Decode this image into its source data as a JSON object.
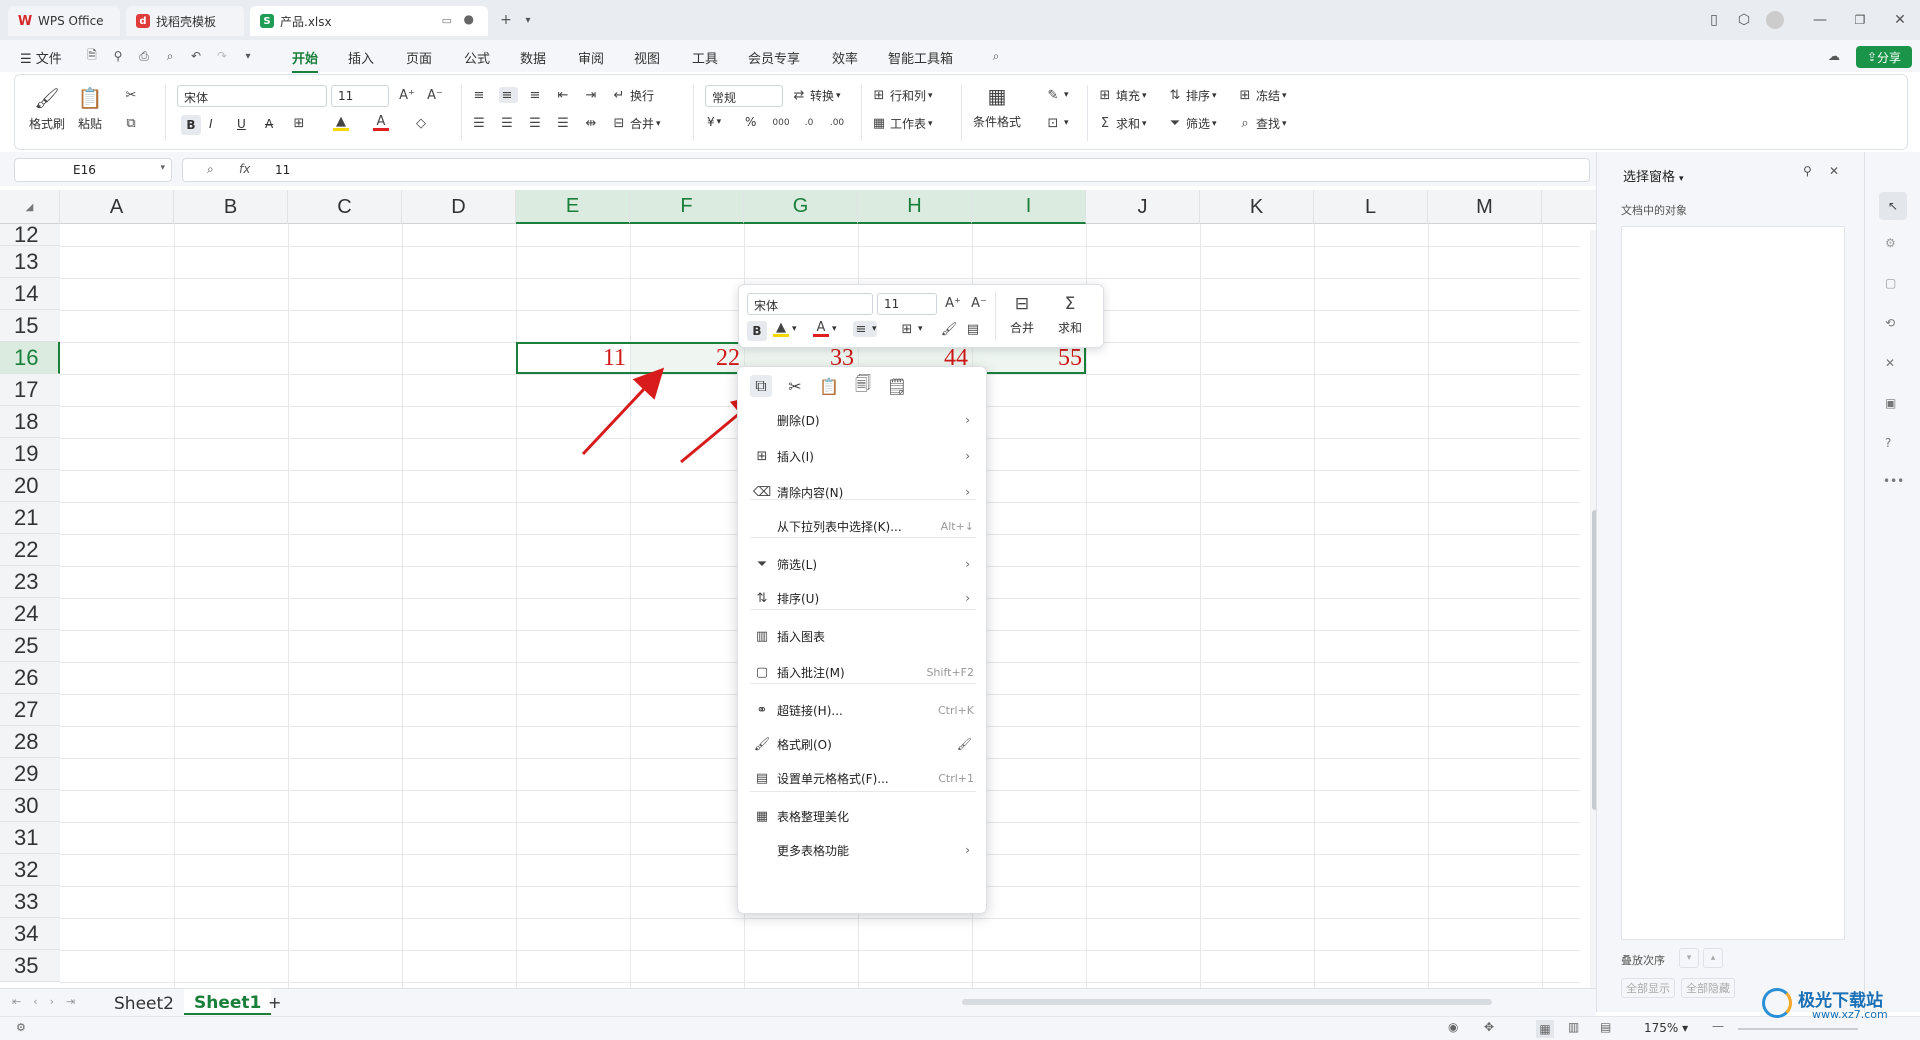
{
  "tabs": [
    {
      "label": "WPS Office"
    },
    {
      "label": "找稻壳模板"
    },
    {
      "label": "产品.xlsx"
    }
  ],
  "menu": {
    "file": "文件",
    "items": [
      "开始",
      "插入",
      "页面",
      "公式",
      "数据",
      "审阅",
      "视图",
      "工具",
      "会员专享",
      "效率",
      "智能工具箱"
    ],
    "active": "开始",
    "share": "分享"
  },
  "ribbon": {
    "format_painter": "格式刷",
    "paste": "粘贴",
    "font": "宋体",
    "size": "11",
    "wrap": "换行",
    "merge": "合并",
    "number_format": "常规",
    "convert": "转换",
    "rowcol": "行和列",
    "worksheet": "工作表",
    "cond_format": "条件格式",
    "fill": "填充",
    "sort": "排序",
    "freeze": "冻结",
    "sum": "求和",
    "filter": "筛选",
    "find": "查找",
    "currency": "¥",
    "percent": "%"
  },
  "formula": {
    "cell_ref": "E16",
    "fx": "fx",
    "value": "11"
  },
  "columns": [
    "A",
    "B",
    "C",
    "D",
    "E",
    "F",
    "G",
    "H",
    "I",
    "J",
    "K",
    "L",
    "M"
  ],
  "rows": [
    "12",
    "13",
    "14",
    "15",
    "16",
    "17",
    "18",
    "19",
    "20",
    "21",
    "22",
    "23",
    "24",
    "25",
    "26",
    "27",
    "28",
    "29",
    "30",
    "31",
    "32",
    "33",
    "34",
    "35"
  ],
  "selected_row": "16",
  "cells": [
    "11",
    "22",
    "33",
    "44",
    "55"
  ],
  "mini_toolbar": {
    "font": "宋体",
    "size": "11",
    "bold": "B",
    "merge": "合并",
    "sum": "求和"
  },
  "context_menu": [
    {
      "label": "删除(D)",
      "shortcut": "",
      "submenu": true,
      "icon": ""
    },
    {
      "label": "插入(I)",
      "shortcut": "",
      "submenu": true,
      "icon": "insert-icon"
    },
    {
      "label": "清除内容(N)",
      "shortcut": "",
      "submenu": true,
      "icon": "clear-icon"
    },
    {
      "label": "从下拉列表中选择(K)...",
      "shortcut": "Alt+↓",
      "submenu": false,
      "icon": ""
    },
    {
      "label": "筛选(L)",
      "shortcut": "",
      "submenu": true,
      "icon": "filter-icon"
    },
    {
      "label": "排序(U)",
      "shortcut": "",
      "submenu": true,
      "icon": "sort-icon"
    },
    {
      "label": "插入图表",
      "shortcut": "",
      "submenu": false,
      "icon": "chart-icon"
    },
    {
      "label": "插入批注(M)",
      "shortcut": "Shift+F2",
      "submenu": false,
      "icon": "comment-icon"
    },
    {
      "label": "超链接(H)...",
      "shortcut": "Ctrl+K",
      "submenu": false,
      "icon": "link-icon"
    },
    {
      "label": "格式刷(O)",
      "shortcut": "",
      "submenu": false,
      "icon": "format-painter-icon"
    },
    {
      "label": "设置单元格格式(F)...",
      "shortcut": "Ctrl+1",
      "submenu": false,
      "icon": "cell-format-icon"
    },
    {
      "label": "表格整理美化",
      "shortcut": "",
      "submenu": false,
      "icon": "beautify-icon"
    },
    {
      "label": "更多表格功能",
      "shortcut": "",
      "submenu": true,
      "icon": ""
    }
  ],
  "right_pane": {
    "title": "选择窗格",
    "subtitle": "文档中的对象",
    "order": "叠放次序",
    "show_all": "全部显示",
    "hide_all": "全部隐藏"
  },
  "sheets": [
    "Sheet2",
    "Sheet1"
  ],
  "active_sheet": "Sheet1",
  "zoom": "175%",
  "watermark": {
    "text": "极光下载站",
    "url": "www.xz7.com"
  },
  "colors": {
    "accent": "#1a7f3a",
    "cell_text": "#d01818",
    "arrow": "#d81c1c"
  }
}
